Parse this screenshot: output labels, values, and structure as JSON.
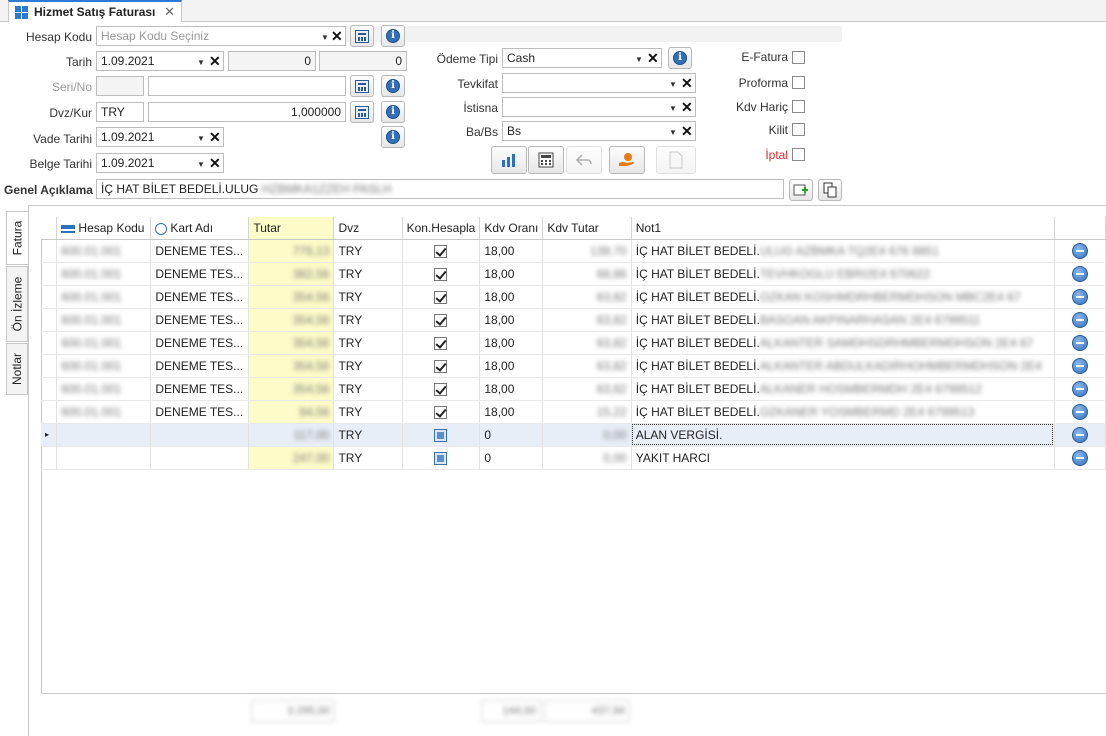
{
  "tab": {
    "title": "Hizmet Satış Faturası",
    "close": "✕"
  },
  "left_form": {
    "hesap_kodu": {
      "label": "Hesap Kodu",
      "placeholder": "Hesap Kodu Seçiniz"
    },
    "tarih": {
      "label": "Tarih",
      "value": "1.09.2021",
      "num1": "0",
      "num2": "0"
    },
    "seri_no": {
      "label": "Seri/No",
      "value": ""
    },
    "dvz_kur": {
      "label": "Dvz/Kur",
      "currency": "TRY",
      "rate": "1,000000"
    },
    "vade_tarihi": {
      "label": "Vade Tarihi",
      "value": "1.09.2021"
    },
    "belge_tarihi": {
      "label": "Belge Tarihi",
      "value": "1.09.2021"
    }
  },
  "mid_form": {
    "odeme_tipi": {
      "label": "Ödeme Tipi",
      "value": "Cash"
    },
    "tevkifat": {
      "label": "Tevkifat",
      "value": ""
    },
    "istisna": {
      "label": "İstisna",
      "value": ""
    },
    "ba_bs": {
      "label": "Ba/Bs",
      "value": "Bs"
    }
  },
  "flags": {
    "e_fatura": {
      "label": "E-Fatura",
      "checked": false
    },
    "proforma": {
      "label": "Proforma",
      "checked": false
    },
    "kdv_haric": {
      "label": "Kdv Hariç",
      "checked": false
    },
    "kilit": {
      "label": "Kilit",
      "checked": false
    },
    "iptal": {
      "label": "İptal",
      "checked": false,
      "color": "#d03030"
    }
  },
  "genel_aciklama": {
    "label": "Genel Açıklama",
    "value": "İÇ HAT BİLET BEDELİ.ULUG",
    "value_blurred": "HZBMKA1ZZEH PASLH"
  },
  "side_tabs": [
    "Fatura",
    "Ön İzleme",
    "Notlar"
  ],
  "grid": {
    "columns": [
      "Hesap Kodu",
      "Kart Adı",
      "Tutar",
      "Dvz",
      "Kon.Hesapla",
      "Kdv Oranı",
      "Kdv Tutar",
      "Not1"
    ],
    "rows": [
      {
        "hesap": "600.01.001",
        "kart": "DENEME TES...",
        "tutar": "776,13",
        "dvz": "TRY",
        "kon": "check",
        "kdv_orani": "18,00",
        "kdv_tutar": "139,70",
        "not1": "İÇ HAT BİLET BEDELİ.",
        "not1_blur": "ULUG AZBMKA TQ2E4 676 8851"
      },
      {
        "hesap": "600.01.001",
        "kart": "DENEME TES...",
        "tutar": "382,56",
        "dvz": "TRY",
        "kon": "check",
        "kdv_orani": "18,00",
        "kdv_tutar": "68,86",
        "not1": "İÇ HAT BİLET BEDELİ.",
        "not1_blur": "TEVHKOGLU EBRI2E4 670622"
      },
      {
        "hesap": "600.01.001",
        "kart": "DENEME TES...",
        "tutar": "354,56",
        "dvz": "TRY",
        "kon": "check",
        "kdv_orani": "18,00",
        "kdv_tutar": "63,82",
        "not1": "İÇ HAT BİLET BEDELİ.",
        "not1_blur": "OZKAN KOSHMDRHBERMDHSON MBC2E4 67"
      },
      {
        "hesap": "600.01.001",
        "kart": "DENEME TES...",
        "tutar": "354,56",
        "dvz": "TRY",
        "kon": "check",
        "kdv_orani": "18,00",
        "kdv_tutar": "63,82",
        "not1": "İÇ HAT BİLET BEDELİ.",
        "not1_blur": "BASOAN AKPINARHASAN 2E4 6799511"
      },
      {
        "hesap": "600.01.001",
        "kart": "DENEME TES...",
        "tutar": "354,56",
        "dvz": "TRY",
        "kon": "check",
        "kdv_orani": "18,00",
        "kdv_tutar": "63,82",
        "not1": "İÇ HAT BİLET BEDELİ.",
        "not1_blur": "ALKANTER SAMDHSDRHMBERMDHSON 2E4 67"
      },
      {
        "hesap": "600.01.001",
        "kart": "DENEME TES...",
        "tutar": "354,56",
        "dvz": "TRY",
        "kon": "check",
        "kdv_orani": "18,00",
        "kdv_tutar": "63,82",
        "not1": "İÇ HAT BİLET BEDELİ.",
        "not1_blur": "ALKANTER ABDULKADIRHOHMBERMDHSON 2E4"
      },
      {
        "hesap": "600.01.001",
        "kart": "DENEME TES...",
        "tutar": "354,56",
        "dvz": "TRY",
        "kon": "check",
        "kdv_orani": "18,00",
        "kdv_tutar": "63,82",
        "not1": "İÇ HAT BİLET BEDELİ.",
        "not1_blur": "ALKANER HOSMBERMDH 2E4 6799512"
      },
      {
        "hesap": "600.01.001",
        "kart": "DENEME TES...",
        "tutar": "84,56",
        "dvz": "TRY",
        "kon": "check",
        "kdv_orani": "18,00",
        "kdv_tutar": "15,22",
        "not1": "İÇ HAT BİLET BEDELİ.",
        "not1_blur": "OZKANER YOSMBERMD 2E4 6799513"
      },
      {
        "hesap": "",
        "kart": "",
        "tutar": "117,00",
        "dvz": "TRY",
        "kon": "square",
        "kdv_orani": "0",
        "kdv_tutar": "0,00",
        "not1": "ALAN VERGİSİ.",
        "not1_blur": "",
        "selected": true
      },
      {
        "hesap": "",
        "kart": "",
        "tutar": "247,00",
        "dvz": "TRY",
        "kon": "square",
        "kdv_orani": "0",
        "kdv_tutar": "0,00",
        "not1": "YAKIT HARCI",
        "not1_blur": ""
      }
    ],
    "footer": {
      "tutar_sum": "3.295,00",
      "kdv_orani_sum": "144,00",
      "kdv_tutar_sum": "437,94"
    }
  }
}
